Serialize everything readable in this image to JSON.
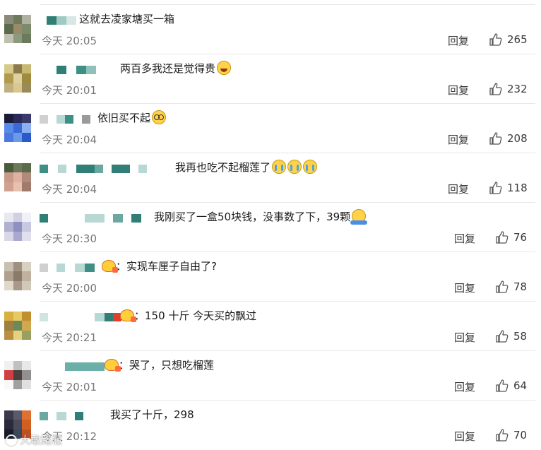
{
  "comments": [
    {
      "text": "这就去凌家塘买一箱",
      "emoji": "",
      "badge": false,
      "time": "今天 20:05",
      "reply": "回复",
      "likes": "265"
    },
    {
      "text": "两百多我还是觉得贵",
      "emoji": "laugh",
      "badge": false,
      "time": "今天 20:01",
      "reply": "回复",
      "likes": "232"
    },
    {
      "text": "依旧买不起",
      "emoji": "glasses",
      "badge": false,
      "time": "今天 20:04",
      "reply": "回复",
      "likes": "208"
    },
    {
      "text": "我再也吃不起榴莲了",
      "emoji": "cry3",
      "badge": false,
      "time": "今天 20:04",
      "reply": "回复",
      "likes": "118"
    },
    {
      "text": "我刚买了一盒50块钱，没事数了下，39颗",
      "emoji": "shrug",
      "badge": false,
      "time": "今天 20:30",
      "reply": "回复",
      "likes": "76"
    },
    {
      "text": "：实现车厘子自由了?",
      "emoji": "",
      "badge": true,
      "time": "今天 20:00",
      "reply": "回复",
      "likes": "78"
    },
    {
      "text": "：150 十斤 今天买的飘过",
      "emoji": "",
      "badge": true,
      "time": "今天 20:21",
      "reply": "回复",
      "likes": "58"
    },
    {
      "text": "：哭了，只想吃榴莲",
      "emoji": "",
      "badge": true,
      "time": "今天 20:01",
      "reply": "回复",
      "likes": "64"
    },
    {
      "text": "我买了十斤，298",
      "emoji": "",
      "badge": false,
      "time": "今天 20:12",
      "reply": "回复",
      "likes": "70"
    }
  ],
  "watermark": "大敢路蒞",
  "colors": {
    "text": "#1a1a1a",
    "meta": "#777777",
    "divider": "#e8e8e8"
  }
}
